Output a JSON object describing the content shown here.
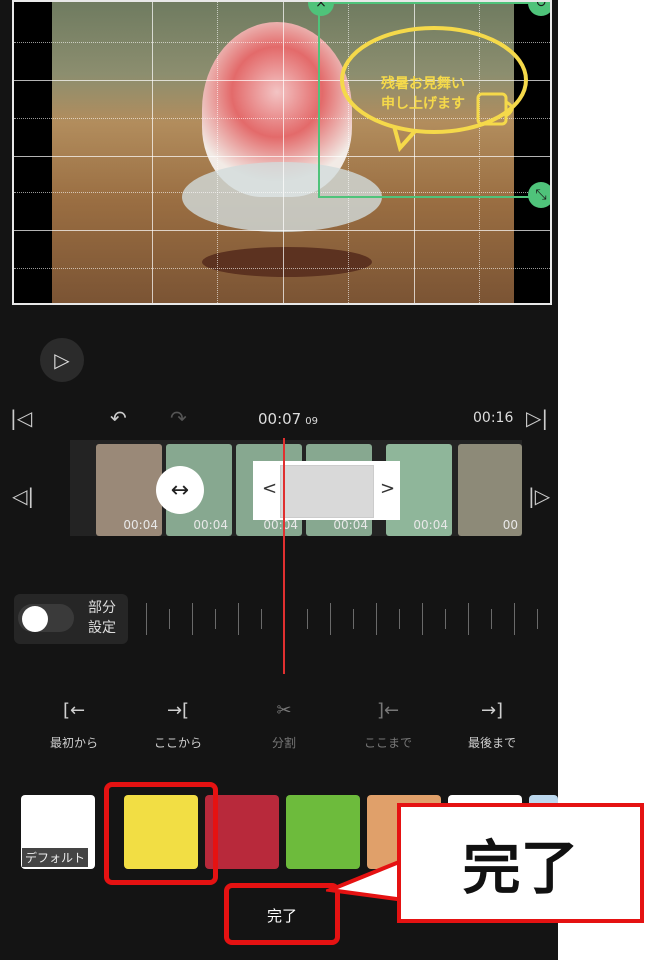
{
  "preview": {
    "sticker_text_line1": "残暑お見舞い",
    "sticker_text_line2": "申し上げます",
    "close_icon": "×",
    "rotate_icon": "↻",
    "resize_icon": "⤡"
  },
  "player": {
    "play_icon": "▷"
  },
  "toolbar": {
    "jump_start_icon": "|◁",
    "undo_icon": "↶",
    "redo_icon": "↷",
    "current_time": "00:07",
    "current_frames": "09",
    "end_time": "00:16",
    "jump_end_icon": "▷|"
  },
  "timeline": {
    "prev_icon": "◁|",
    "next_icon": "|▷",
    "move_icon": "↔",
    "trim_left_icon": "<",
    "trim_right_icon": ">",
    "thumbs": [
      "00:04",
      "00:04",
      "00:04",
      "00:04",
      "00:04",
      "00"
    ]
  },
  "partial": {
    "label_line1": "部分",
    "label_line2": "設定",
    "enabled": false
  },
  "actions": [
    {
      "icon": "[←",
      "label": "最初から"
    },
    {
      "icon": "→[",
      "label": "ここから"
    },
    {
      "icon": "✂",
      "label": "分割"
    },
    {
      "icon": "]←",
      "label": "ここまで"
    },
    {
      "icon": "→]",
      "label": "最後まで"
    }
  ],
  "swatches": {
    "default_label": "デフォルト",
    "colors": [
      "#ffffff",
      "#f2de44",
      "#b8293b",
      "#6dbb3c",
      "#e0a06a",
      "#ffffff",
      "#bcd8ee"
    ]
  },
  "done_label": "完了",
  "annotation": {
    "callout_text": "完了",
    "highlight_color": "#e51212"
  }
}
